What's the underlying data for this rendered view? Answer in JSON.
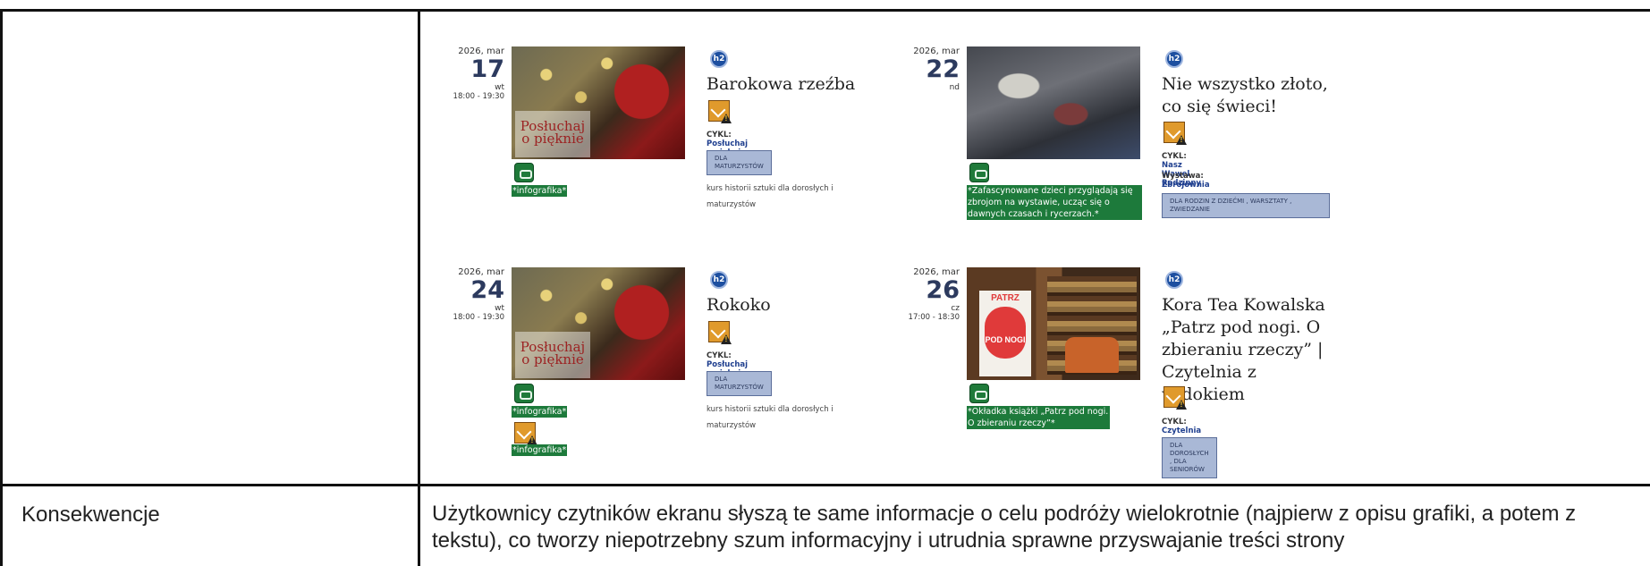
{
  "table": {
    "consequences_label": "Konsekwencje",
    "consequences_text": "Użytkownicy czytników ekranu słyszą te same informacje o celu podróży wielokrotnie (najpierw z opisu grafiki, a potem z tekstu), co tworzy niepotrzebny szum informacyjny i utrudnia sprawne przyswajanie treści strony"
  },
  "events": [
    {
      "date": {
        "year_month": "2026, mar",
        "day": "17",
        "weekday": "wt",
        "time": "18:00 - 19:30"
      },
      "image_overlay_text": "Posłuchaj\no pięknie",
      "alt_tags": [
        "*infografika*"
      ],
      "heading_level": "h2",
      "title": "Barokowa rzeźba",
      "cycle_label": "CYKL:",
      "cycle": "Posłuchaj o pięknie",
      "category": "DLA MATURZYSTÓW",
      "description": "kurs historii sztuki dla dorosłych i maturzystów"
    },
    {
      "date": {
        "year_month": "2026, mar",
        "day": "22",
        "weekday": "nd",
        "time": ""
      },
      "alt_tags": [
        "*Zafascynowane dzieci przyglądają się zbrojom na wystawie, ucząc się o dawnych czasach i rycerzach.*"
      ],
      "heading_level": "h2",
      "title": "Nie wszystko złoto, co się świeci!",
      "cycle_label": "CYKL:",
      "cycle": "Nasz Wawel Rodzinny",
      "exhibition_label": "Wystawa:",
      "exhibition": "Zbrojownia",
      "category": "DLA RODZIN Z DZIEĆMI , WARSZTATY , ZWIEDZANIE"
    },
    {
      "date": {
        "year_month": "2026, mar",
        "day": "24",
        "weekday": "wt",
        "time": "18:00 - 19:30"
      },
      "image_overlay_text": "Posłuchaj\no pięknie",
      "alt_tags": [
        "*infografika*",
        "*infografika*"
      ],
      "heading_level": "h2",
      "title": "Rokoko",
      "cycle_label": "CYKL:",
      "cycle": "Posłuchaj o pięknie",
      "category": "DLA MATURZYSTÓW",
      "description": "kurs historii sztuki dla dorosłych i maturzystów"
    },
    {
      "date": {
        "year_month": "2026, mar",
        "day": "26",
        "weekday": "cz",
        "time": "17:00 - 18:30"
      },
      "book_cover": {
        "top": "PATRZ",
        "bottom": "POD NOGI"
      },
      "alt_tags": [
        "*Okładka książki „Patrz pod nogi. O zbieraniu rzeczy”*"
      ],
      "heading_level": "h2",
      "title": "Kora Tea Kowalska „Patrz pod nogi. O zbieraniu rzeczy” | Czytelnia z widokiem",
      "cycle_label": "CYKL:",
      "cycle": "Czytelnia z widokiem",
      "category": "DLA DOROSŁYCH , DLA SENIORÓW"
    }
  ]
}
